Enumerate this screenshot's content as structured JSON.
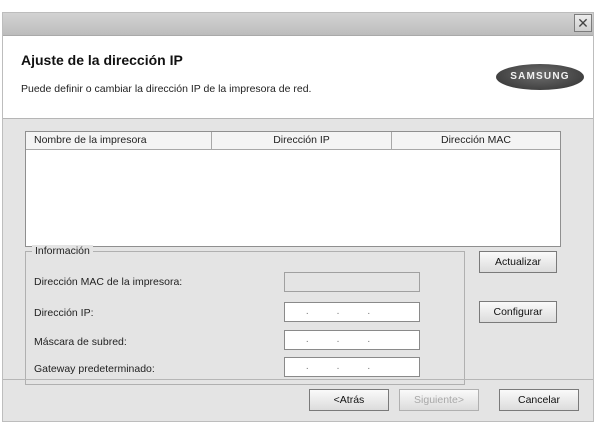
{
  "window": {
    "close_glyph": "✕"
  },
  "header": {
    "title": "Ajuste de la dirección IP",
    "subtitle": "Puede definir o cambiar la dirección IP de la impresora de red.",
    "logo_text": "SAMSUNG"
  },
  "printer_table": {
    "columns": [
      "Nombre de la impresora",
      "Dirección IP",
      "Dirección MAC"
    ],
    "rows": []
  },
  "info": {
    "legend": "Información",
    "mac_label": "Dirección MAC de la impresora:",
    "ip_label": "Dirección IP:",
    "mask_label": "Máscara de subred:",
    "gateway_label": "Gateway predeterminado:",
    "mac_value": "",
    "ip_value": "...",
    "mask_value": "...",
    "gateway_value": "..."
  },
  "buttons": {
    "update": "Actualizar",
    "configure": "Configurar",
    "back": "<Atrás",
    "next": "Siguiente>",
    "cancel": "Cancelar"
  }
}
